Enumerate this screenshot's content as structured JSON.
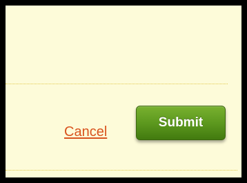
{
  "form_actions": {
    "cancel_label": "Cancel",
    "submit_label": "Submit"
  },
  "colors": {
    "panel_background": "#fdfbd9",
    "frame_border": "#000000",
    "divider": "#e2c84a",
    "cancel_link": "#d9531e",
    "submit_button": "#5e9a1f",
    "submit_text": "#ffffff"
  }
}
